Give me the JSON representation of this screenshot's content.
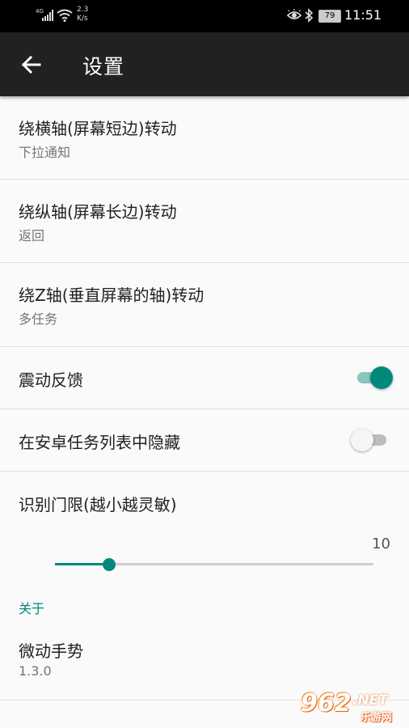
{
  "status_bar": {
    "network_type": "4G",
    "speed_value": "2.3",
    "speed_unit": "K/s",
    "battery": "79",
    "time": "11:51"
  },
  "app_bar": {
    "title": "设置",
    "back_icon": "arrow-left-icon"
  },
  "settings": {
    "items": [
      {
        "title": "绕横轴(屏幕短边)转动",
        "summary": "下拉通知"
      },
      {
        "title": "绕纵轴(屏幕长边)转动",
        "summary": "返回"
      },
      {
        "title": "绕Z轴(垂直屏幕的轴)转动",
        "summary": "多任务"
      }
    ],
    "vibration": {
      "title": "震动反馈",
      "enabled": true
    },
    "hide_in_recents": {
      "title": "在安卓任务列表中隐藏",
      "enabled": false
    },
    "threshold": {
      "title": "识别门限(越小越灵敏)",
      "value": "10",
      "fraction": 0.17
    }
  },
  "about": {
    "category": "关于",
    "app_name": "微动手势",
    "version": "1.3.0"
  },
  "watermark": {
    "number": "962",
    "suffix": ".NET",
    "text": "乐游网"
  },
  "colors": {
    "accent": "#00897b",
    "app_bar": "#212121",
    "background": "#fafafa"
  }
}
